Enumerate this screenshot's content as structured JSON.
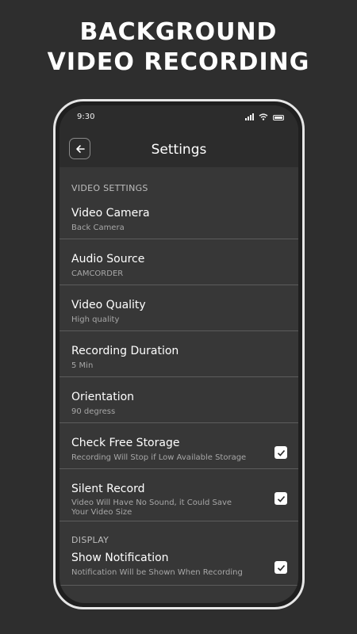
{
  "headline": {
    "line1": "BACKGROUND",
    "line2": "VIDEO RECORDING"
  },
  "status": {
    "time": "9:30"
  },
  "appbar": {
    "title": "Settings"
  },
  "sections": {
    "video": "VIDEO SETTINGS",
    "display": "DISPLAY"
  },
  "rows": [
    {
      "title": "Video Camera",
      "subtitle": "Back Camera"
    },
    {
      "title": "Audio Source",
      "subtitle": "CAMCORDER"
    },
    {
      "title": "Video Quality",
      "subtitle": "High quality"
    },
    {
      "title": "Recording Duration",
      "subtitle": "5 Min"
    },
    {
      "title": "Orientation",
      "subtitle": "90 degress"
    },
    {
      "title": "Check Free Storage",
      "subtitle": "Recording Will Stop if Low Available Storage",
      "checked": true
    },
    {
      "title": "Silent Record",
      "subtitle": "Video Will Have No Sound, it Could Save Your Video Size",
      "checked": true
    },
    {
      "title": "Show Notification",
      "subtitle": "Notification Will be Shown When Recording",
      "checked": true
    }
  ],
  "colors": {
    "background": "#2e2e2e",
    "screen": "#373737",
    "bar": "#2c2c2c",
    "divider": "#5c5c5c"
  }
}
